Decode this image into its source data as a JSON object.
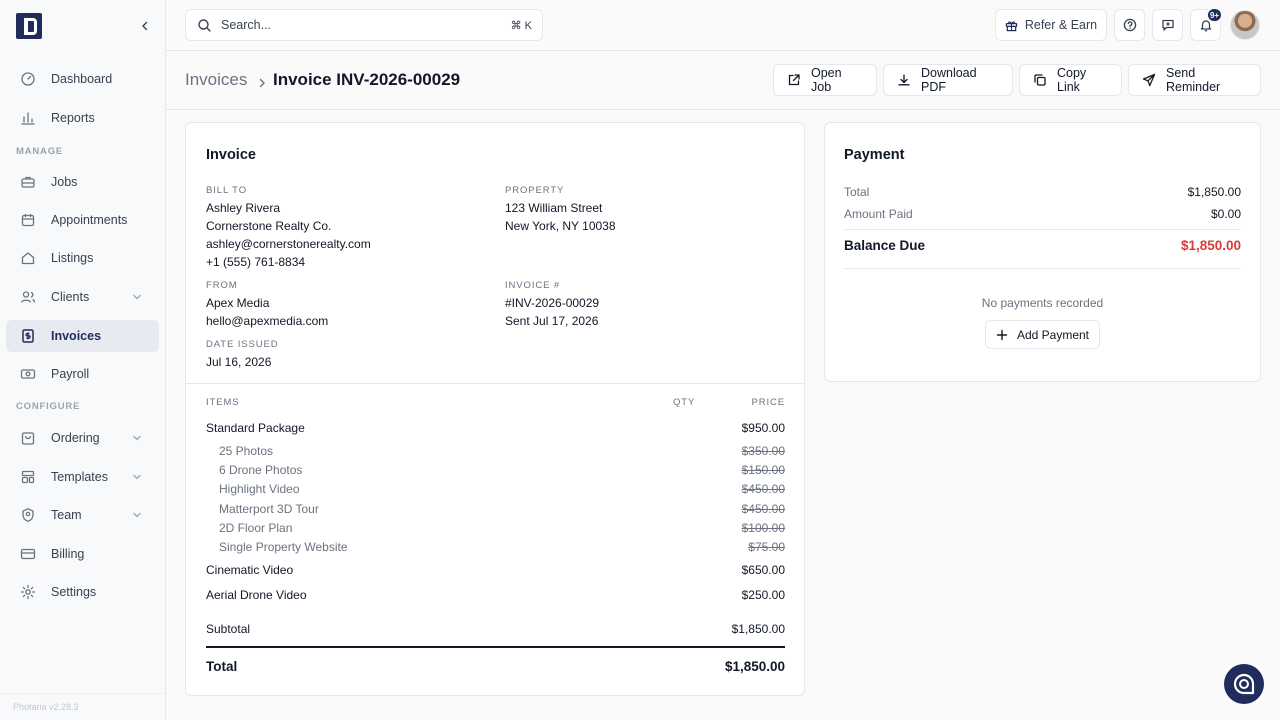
{
  "sidebar": {
    "items": [
      {
        "label": "Dashboard"
      },
      {
        "label": "Reports"
      },
      {
        "label": "Jobs"
      },
      {
        "label": "Appointments"
      },
      {
        "label": "Listings"
      },
      {
        "label": "Clients"
      },
      {
        "label": "Invoices"
      },
      {
        "label": "Payroll"
      },
      {
        "label": "Ordering"
      },
      {
        "label": "Templates"
      },
      {
        "label": "Team"
      },
      {
        "label": "Billing"
      },
      {
        "label": "Settings"
      }
    ],
    "section_manage": "MANAGE",
    "section_configure": "CONFIGURE",
    "version": "Photaria v2.28.3"
  },
  "topbar": {
    "search_placeholder": "Search...",
    "shortcut": "⌘ K",
    "refer_label": "Refer & Earn",
    "notifications_badge": "9+"
  },
  "header": {
    "breadcrumb_parent": "Invoices",
    "breadcrumb_current": "Invoice INV-2026-00029",
    "actions": {
      "open_job": "Open Job",
      "download_pdf": "Download PDF",
      "copy_link": "Copy Link",
      "send_reminder": "Send Reminder"
    }
  },
  "invoice": {
    "title": "Invoice",
    "bill_to_label": "BILL TO",
    "bill_to": {
      "name": "Ashley Rivera",
      "company": "Cornerstone Realty Co.",
      "email": "ashley@cornerstonerealty.com",
      "phone": "+1 (555) 761-8834"
    },
    "property_label": "PROPERTY",
    "property": {
      "line1": "123 William Street",
      "line2": "New York, NY 10038"
    },
    "from_label": "FROM",
    "from": {
      "name": "Apex Media",
      "email": "hello@apexmedia.com"
    },
    "invoice_no_label": "INVOICE #",
    "invoice_no": "#INV-2026-00029",
    "sent": "Sent Jul 17, 2026",
    "date_issued_label": "DATE ISSUED",
    "date_issued": "Jul 16, 2026",
    "items_head": {
      "items": "ITEMS",
      "qty": "QTY",
      "price": "PRICE"
    },
    "items": {
      "standard": {
        "name": "Standard Package",
        "price": "$950.00"
      },
      "sub": [
        {
          "name": "25 Photos",
          "price": "$350.00"
        },
        {
          "name": "6 Drone Photos",
          "price": "$150.00"
        },
        {
          "name": "Highlight Video",
          "price": "$450.00"
        },
        {
          "name": "Matterport 3D Tour",
          "price": "$450.00"
        },
        {
          "name": "2D Floor Plan",
          "price": "$100.00"
        },
        {
          "name": "Single Property Website",
          "price": "$75.00"
        }
      ],
      "cinematic": {
        "name": "Cinematic Video",
        "price": "$650.00"
      },
      "aerial": {
        "name": "Aerial Drone Video",
        "price": "$250.00"
      }
    },
    "subtotal_label": "Subtotal",
    "subtotal": "$1,850.00",
    "total_label": "Total",
    "total": "$1,850.00"
  },
  "payment": {
    "title": "Payment",
    "total_label": "Total",
    "total": "$1,850.00",
    "paid_label": "Amount Paid",
    "paid": "$0.00",
    "balance_label": "Balance Due",
    "balance": "$1,850.00",
    "empty": "No payments recorded",
    "add_label": "Add Payment"
  },
  "colors": {
    "brand": "#1f2c5c",
    "balance_due": "#dc3b3b",
    "active_nav_bg": "#e8eaf1"
  }
}
